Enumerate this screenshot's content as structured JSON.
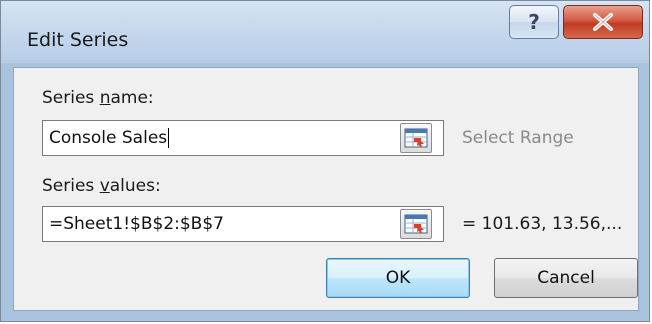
{
  "window": {
    "title": "Edit Series",
    "help_glyph": "?",
    "close_glyph": "X"
  },
  "series_name": {
    "label_pre": "Series ",
    "label_key": "n",
    "label_post": "ame:",
    "value": "Console Sales",
    "side_text": "Select Range"
  },
  "series_values": {
    "label_pre": "Series ",
    "label_key": "v",
    "label_post": "alues:",
    "value": "=Sheet1!$B$2:$B$7",
    "side_text": "= 101.63, 13.56,..."
  },
  "buttons": {
    "ok": "OK",
    "cancel": "Cancel"
  },
  "colors": {
    "close_red": "#c23a22",
    "default_button_border": "#3c7fb1",
    "muted_text": "#8a8a8a"
  }
}
